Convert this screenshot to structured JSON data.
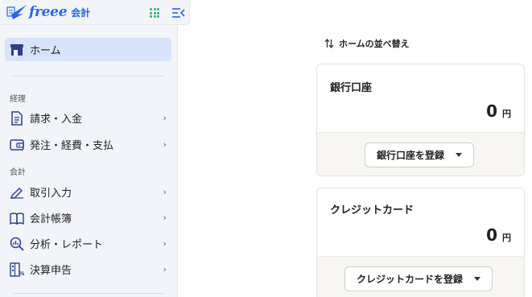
{
  "sidebar": {
    "logo_word": "freee",
    "logo_product": "会計",
    "home": "ホーム",
    "sections": {
      "accounting_ops": "経理",
      "accounting": "会計"
    },
    "items": {
      "billing": "請求・入金",
      "ordering": "発注・経費・支払",
      "transactions": "取引入力",
      "ledgers": "会計帳簿",
      "reports": "分析・レポート",
      "closing": "決算申告"
    }
  },
  "main": {
    "sort_label": "ホームの並べ替え",
    "cards": {
      "bank": {
        "title": "銀行口座",
        "amount": "0",
        "unit": "円",
        "button": "銀行口座を登録"
      },
      "credit": {
        "title": "クレジットカード",
        "amount": "0",
        "unit": "円",
        "button": "クレジットカードを登録"
      }
    }
  },
  "colors": {
    "brand": "#2864f0",
    "apps": "#2bb673",
    "active_bg": "#d6e3fb"
  }
}
